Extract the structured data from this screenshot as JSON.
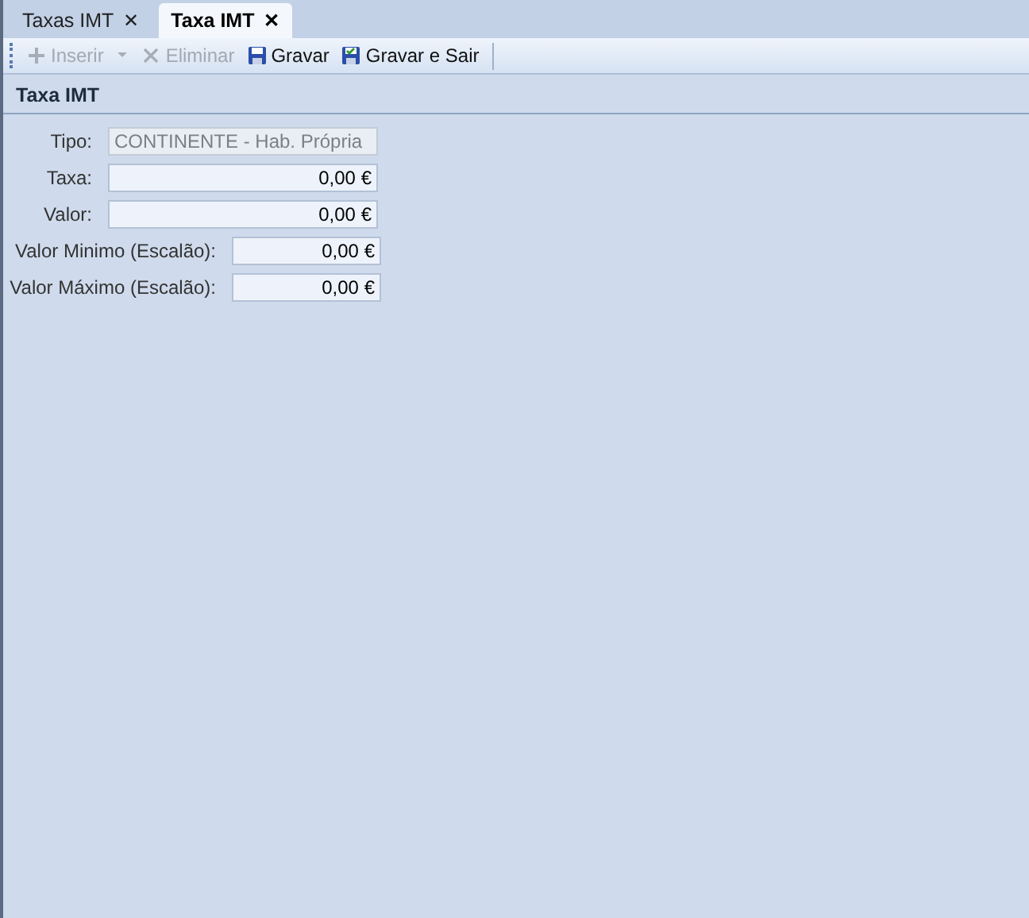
{
  "tabs": [
    {
      "label": "Taxas IMT",
      "close": "✕",
      "selected": false
    },
    {
      "label": "Taxa IMT",
      "close": "✕",
      "selected": true
    }
  ],
  "toolbar": [
    {
      "label": "Inserir",
      "kind": "plus",
      "disabled": true,
      "dropdown": true
    },
    {
      "label": "Eliminar",
      "kind": "x",
      "disabled": true,
      "dropdown": false
    },
    {
      "label": "Gravar",
      "kind": "save",
      "disabled": false,
      "dropdown": false
    },
    {
      "label": "Gravar e Sair",
      "kind": "save-exit",
      "disabled": false,
      "dropdown": false
    }
  ],
  "section": {
    "title": "Taxa IMT"
  },
  "fields": [
    {
      "label": "Tipo:",
      "value": "CONTINENTE - Hab. Própria",
      "kind": "long",
      "disabled": true
    },
    {
      "label": "Taxa:",
      "value": "0,00 €",
      "kind": "long",
      "disabled": false
    },
    {
      "label": "Valor:",
      "value": "0,00 €",
      "kind": "long",
      "disabled": false
    },
    {
      "label": "Valor Minimo (Escalão):",
      "value": "0,00 €",
      "kind": "short",
      "disabled": false
    },
    {
      "label": "Valor Máximo (Escalão):",
      "value": "0,00 €",
      "kind": "short",
      "disabled": false
    }
  ]
}
